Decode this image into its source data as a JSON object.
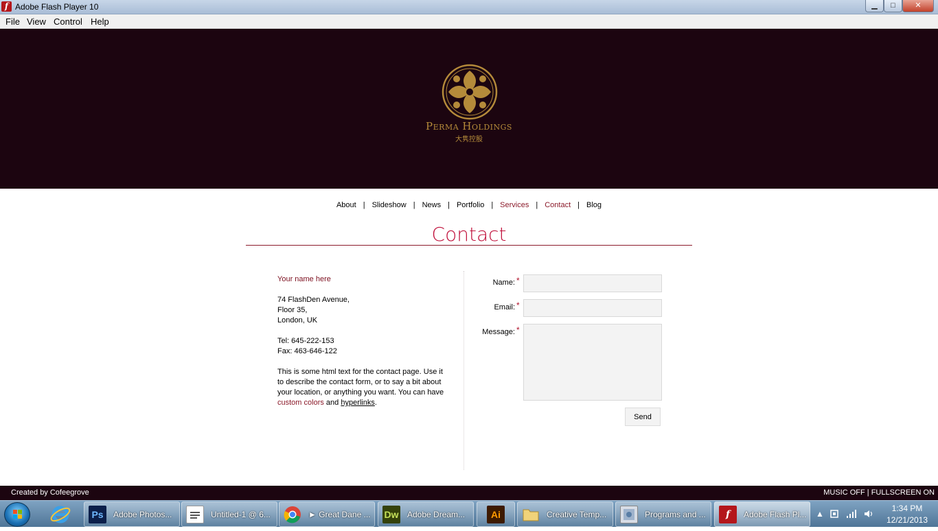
{
  "window": {
    "title": "Adobe Flash Player 10",
    "app_icon_glyph": "f",
    "controls": {
      "minimize": "▁",
      "maximize": "□",
      "close": "✕"
    }
  },
  "menu": [
    "File",
    "View",
    "Control",
    "Help"
  ],
  "header": {
    "brand_name": "Perma Holdings",
    "brand_subtitle": "大隽控股",
    "background_color": "#1c0510",
    "logo_color": "#b58b3a"
  },
  "nav": {
    "items": [
      {
        "label": "About",
        "active": false
      },
      {
        "label": "Slideshow",
        "active": false
      },
      {
        "label": "News",
        "active": false
      },
      {
        "label": "Portfolio",
        "active": false
      },
      {
        "label": "Services",
        "active": true
      },
      {
        "label": "Contact",
        "active": true
      },
      {
        "label": "Blog",
        "active": false
      }
    ],
    "separator": "|"
  },
  "page": {
    "heading": "Contact",
    "accent_color": "#c0103b"
  },
  "contact": {
    "name": "Your name here",
    "address_line1": "74 FlashDen Avenue,",
    "address_line2": "Floor 35,",
    "address_line3": "London, UK",
    "tel": "Tel: 645-222-153",
    "fax": "Fax: 463-646-122",
    "body_part1": "This is some html text for the contact page. Use it to describe the contact form, or to say a bit about your location, or anything you want. You can have",
    "custom_colors": "custom colors",
    "and": "and",
    "hyperlinks": "hyperlinks",
    "period": "."
  },
  "form": {
    "name_label": "Name:",
    "email_label": "Email:",
    "message_label": "Message:",
    "required_mark": "*",
    "name_value": "",
    "email_value": "",
    "message_value": "",
    "send_label": "Send"
  },
  "footer": {
    "credit": "Created by Cofeegrove",
    "music": "MUSIC OFF",
    "separator": "|",
    "fullscreen": "FULLSCREEN ON"
  },
  "taskbar": {
    "tasks": [
      {
        "label": "Adobe Photos...",
        "icon": "Ps",
        "icon_bg": "#0c1f4a",
        "icon_color": "#6fb8ff",
        "active": false
      },
      {
        "label": "Untitled-1 @ 6...",
        "icon": "doc",
        "icon_bg": "#ffffff",
        "icon_color": "#333333",
        "active": false
      },
      {
        "label": "► Great Dane ...",
        "icon": "chrome",
        "icon_bg": "#ffffff",
        "icon_color": "#333333",
        "active": false
      },
      {
        "label": "Adobe Dream...",
        "icon": "Dw",
        "icon_bg": "#35420a",
        "icon_color": "#c6e25a",
        "active": false
      },
      {
        "label": "",
        "icon": "Ai",
        "icon_bg": "#3d1a00",
        "icon_color": "#ff9a00",
        "active": false
      },
      {
        "label": "Creative Temp...",
        "icon": "folder",
        "icon_bg": "#f1d37a",
        "icon_color": "#8a6a18",
        "active": false
      },
      {
        "label": "Programs and ...",
        "icon": "programs",
        "icon_bg": "#d8dde6",
        "icon_color": "#333333",
        "active": false
      },
      {
        "label": "Adobe Flash Pl...",
        "icon": "f",
        "icon_bg": "#b4161b",
        "icon_color": "#ffffff",
        "active": true
      }
    ],
    "tray": {
      "show_hidden": "▲",
      "time": "1:34 PM",
      "date": "12/21/2013"
    }
  }
}
